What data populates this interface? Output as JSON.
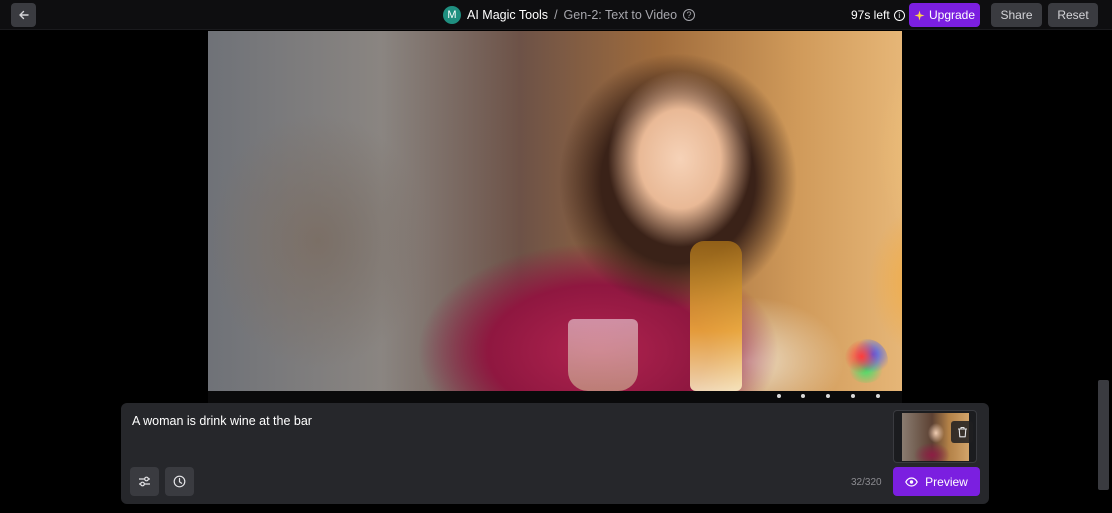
{
  "header": {
    "avatar_letter": "M",
    "app_name": "AI Magic Tools",
    "separator": "/",
    "page_title": "Gen-2: Text to Video",
    "time_left": "97s left",
    "upgrade_label": "Upgrade",
    "share_label": "Share",
    "reset_label": "Reset",
    "icons": {
      "back": "arrow-left-icon",
      "help": "question-circle-icon",
      "info": "info-circle-icon",
      "upgrade": "sparkle-icon"
    }
  },
  "video": {
    "description_icon": "video-preview"
  },
  "prompt": {
    "text": "A woman is drink wine at the bar",
    "char_count": "32/320",
    "preview_label": "Preview",
    "icons": {
      "settings": "sliders-icon",
      "history": "clock-icon",
      "delete": "trash-icon",
      "preview": "eye-icon"
    }
  },
  "colors": {
    "accent": "#7b1fe0",
    "panel": "#26272b",
    "button": "#3a3b40",
    "avatar": "#1f8f80"
  }
}
